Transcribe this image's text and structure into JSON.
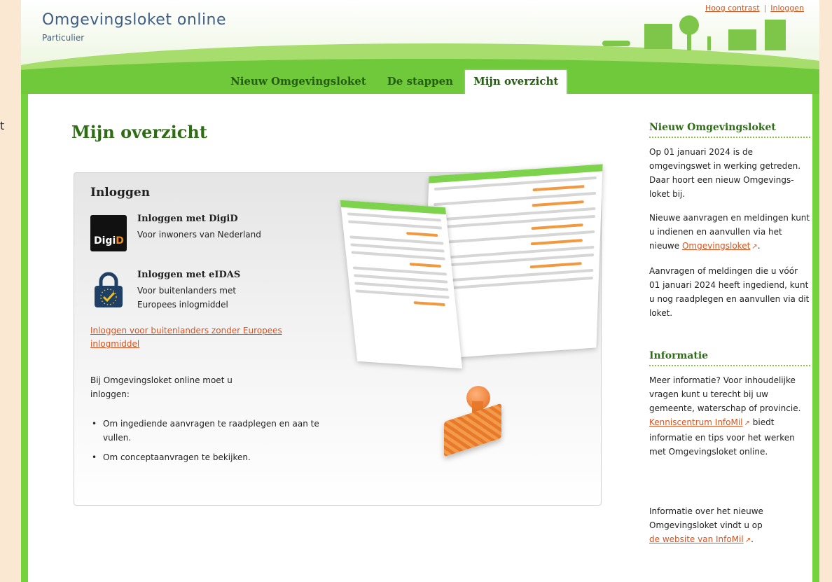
{
  "stray": "t",
  "header": {
    "title": "Omgevingsloket online",
    "subtitle": "Particulier",
    "links": [
      "Hoog contrast",
      "Inloggen"
    ],
    "separator": "|"
  },
  "tabs": [
    {
      "label": "Nieuw Omgevingsloket"
    },
    {
      "label": "De stappen"
    },
    {
      "label": "Mijn overzicht",
      "active": true
    }
  ],
  "main": {
    "title": "Mijn overzicht",
    "panel": {
      "heading": "Inloggen",
      "digid": {
        "title": "Inloggen met DigiD",
        "desc": "Voor inwoners van Nederland",
        "logo_text_1": "Digi",
        "logo_text_2": "D"
      },
      "eidas": {
        "title": "Inloggen met eIDAS",
        "desc": "Voor buitenlanders met Europees inlogmiddel"
      },
      "alt_link": "Inloggen voor buitenlanders zonder Europees inlogmiddel",
      "intro": "Bij Omgevingsloket online moet u inloggen:",
      "bullets": [
        "Om ingediende aanvragen te raadplegen en aan te vullen.",
        "Om conceptaanvragen te bekijken."
      ]
    }
  },
  "sidebar": {
    "section1": {
      "heading": "Nieuw Omgevingsloket",
      "p1": "Op 01 januari 2024 is de omgevingswet in werking getreden. Daar hoort een nieuw Omgevings-loket bij.",
      "p2_before": "Nieuwe aanvragen en meldingen kunt u indienen en aanvullen via het nieuwe ",
      "p2_link": "Omgevingsloket",
      "p2_after": ".",
      "p3": "Aanvragen of meldingen die u vóór 01 januari 2024 heeft ingediend, kunt u nog raadplegen en aanvullen via dit loket."
    },
    "section2": {
      "heading": "Informatie",
      "p1_before": "Meer informatie? Voor inhoudelijke vragen kunt u terecht bij uw gemeente, waterschap of provincie. ",
      "p1_link": "Kenniscentrum InfoMil",
      "p1_after": " biedt informatie en tips voor het werken met Omgevingsloket online."
    },
    "section3": {
      "text": "Informatie over het nieuwe Omgevingsloket vindt u op",
      "link": "de website van InfoMil",
      "after": "."
    }
  },
  "colors": {
    "brand_green": "#2e6d14",
    "accent_orange": "#d9531e",
    "frame_green": "#74d23d"
  },
  "icons": {
    "external_link": "↗"
  }
}
